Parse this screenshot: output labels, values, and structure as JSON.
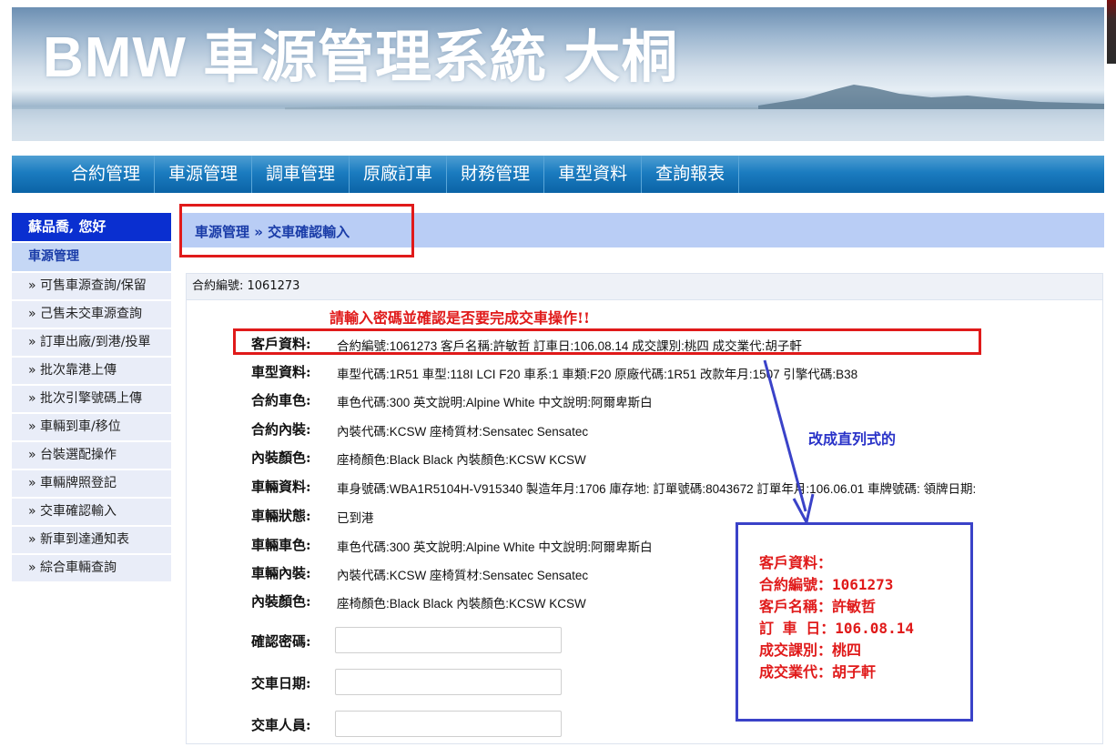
{
  "banner": {
    "title": "BMW 車源管理系統 大桐"
  },
  "nav": {
    "items": [
      "合約管理",
      "車源管理",
      "調車管理",
      "原廠訂車",
      "財務管理",
      "車型資料",
      "查詢報表"
    ]
  },
  "sidebar": {
    "greeting": "蘇品喬, 您好",
    "section": "車源管理",
    "items": [
      "» 可售車源查詢/保留",
      "» 己售未交車源查詢",
      "» 訂車出廠/到港/投單",
      "» 批次靠港上傳",
      "» 批次引擎號碼上傳",
      "» 車輛到車/移位",
      "» 台裝選配操作",
      "» 車輛牌照登記",
      "» 交車確認輸入",
      "» 新車到達通知表",
      "» 綜合車輛查詢"
    ]
  },
  "breadcrumb": "車源管理 » 交車確認輸入",
  "contract_bar": "合約編號: 1061273",
  "warning": "請輸入密碼並確認是否要完成交車操作!!",
  "details": {
    "customer": {
      "label": "客戶資料:",
      "value": "合約編號:1061273   客戶名稱:許敏哲   訂車日:106.08.14   成交課別:桃四   成交業代:胡子軒"
    },
    "model": {
      "label": "車型資料:",
      "value": "車型代碼:1R51   車型:118I LCI F20   車系:1   車類:F20   原廠代碼:1R51   改款年月:1507   引擎代碼:B38"
    },
    "contract_color": {
      "label": "合約車色:",
      "value": "車色代碼:300   英文說明:Alpine White   中文說明:阿爾卑斯白"
    },
    "contract_interior": {
      "label": "合約內裝:",
      "value": "內裝代碼:KCSW   座椅質材:Sensatec   Sensatec"
    },
    "interior_color_1": {
      "label": "內裝顏色:",
      "value": "座椅顏色:Black   Black   內裝顏色:KCSW   KCSW"
    },
    "vehicle": {
      "label": "車輛資料:",
      "value": "車身號碼:WBA1R5104H-V915340   製造年月:1706   庫存地:   訂單號碼:8043672   訂單年月:106.06.01   車牌號碼:   領牌日期:"
    },
    "status": {
      "label": "車輛狀態:",
      "value": "已到港"
    },
    "vehicle_color": {
      "label": "車輛車色:",
      "value": "車色代碼:300   英文說明:Alpine White   中文說明:阿爾卑斯白"
    },
    "vehicle_interior": {
      "label": "車輛內裝:",
      "value": "內裝代碼:KCSW   座椅質材:Sensatec   Sensatec"
    },
    "interior_color_2": {
      "label": "內裝顏色:",
      "value": "座椅顏色:Black   Black   內裝顏色:KCSW   KCSW"
    }
  },
  "form": {
    "password_label": "確認密碼:",
    "date_label": "交車日期:",
    "staff_label": "交車人員:",
    "password_value": "",
    "date_value": "",
    "staff_value": ""
  },
  "annotation": {
    "note": "改成直列式的",
    "lines": [
      "客戶資料：",
      "合約編號：1061273",
      "客戶名稱：許敏哲",
      "訂 車 日：106.08.14",
      "成交課別：桃四",
      "成交業代：胡子軒"
    ]
  },
  "colors": {
    "nav_blue": "#1b7cc0",
    "sidebar_header": "#0a2fd0",
    "crumb_bg": "#b9cdf5",
    "highlight_red": "#e01a1a",
    "annotation_blue": "#3a42c8"
  }
}
